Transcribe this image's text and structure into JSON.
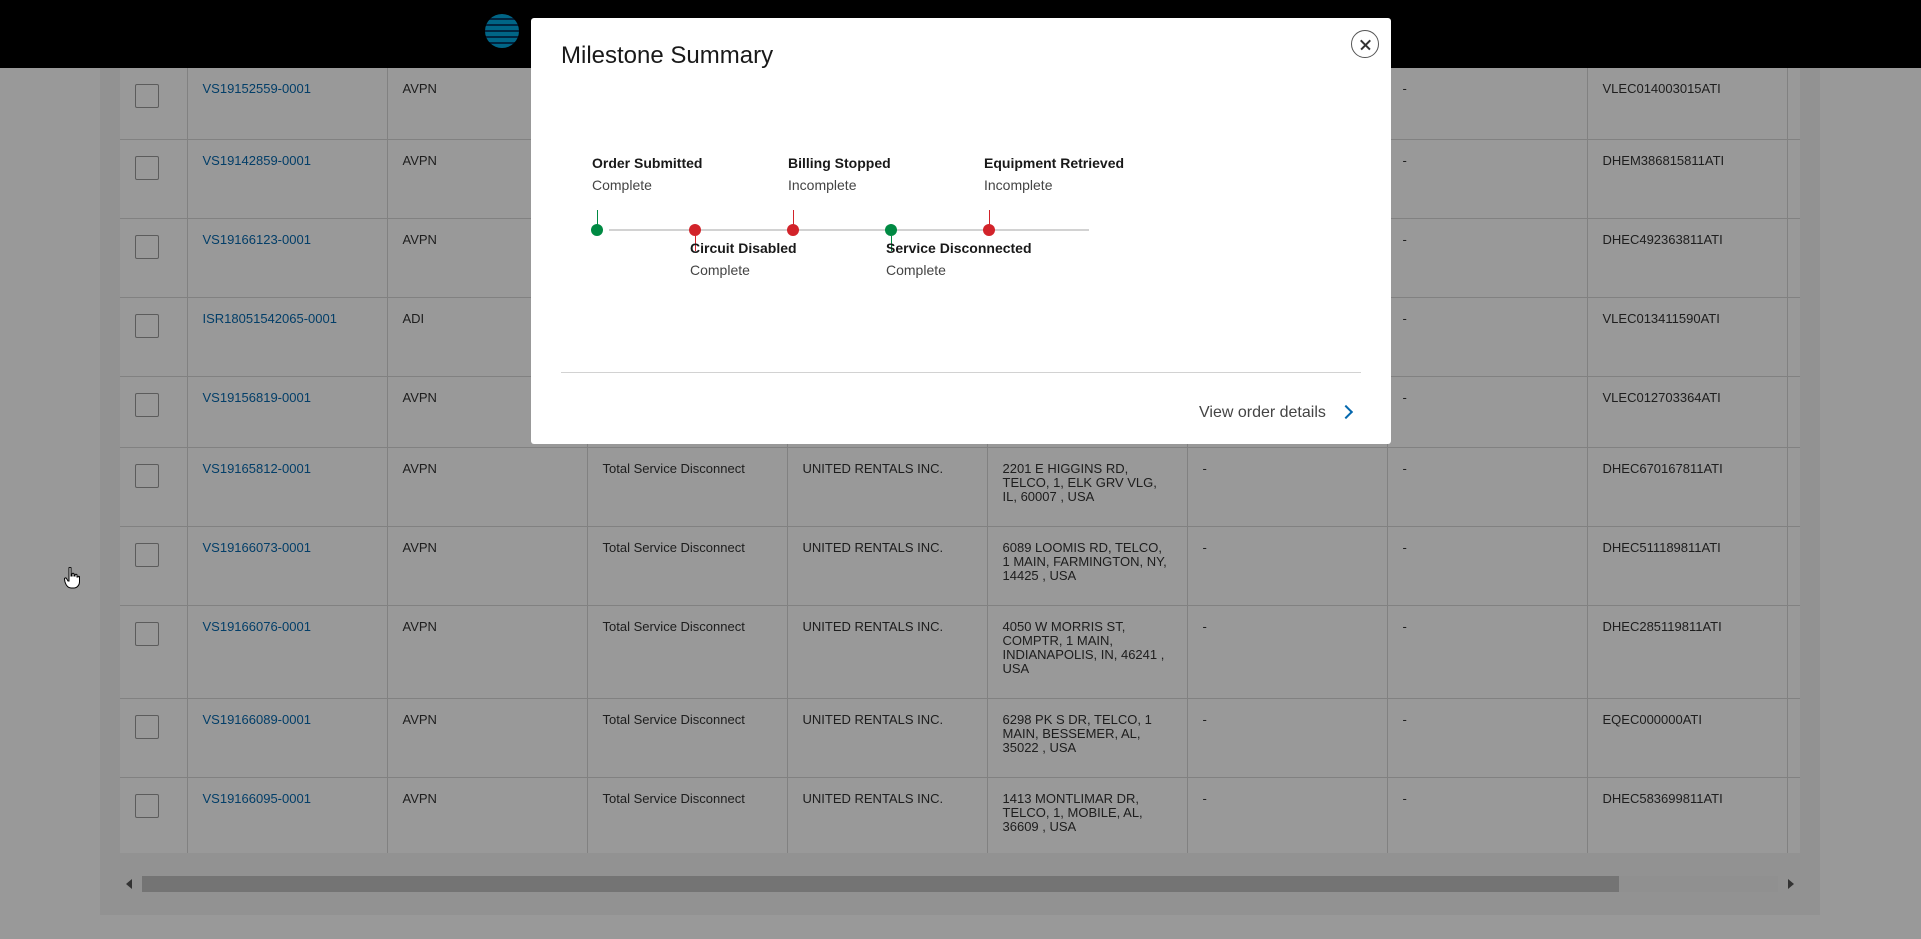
{
  "table": {
    "rows": [
      {
        "order": "VS19152559-0001",
        "product": "AVPN",
        "type": "",
        "customer": "",
        "address": "",
        "col_a": "",
        "col_b": "-",
        "circuit": "VLEC014003015ATI"
      },
      {
        "order": "VS19142859-0001",
        "product": "AVPN",
        "type": "",
        "customer": "",
        "address": "",
        "col_a": "",
        "col_b": "-",
        "circuit": "DHEM386815811ATI"
      },
      {
        "order": "VS19166123-0001",
        "product": "AVPN",
        "type": "",
        "customer": "",
        "address": "",
        "col_a": "",
        "col_b": "-",
        "circuit": "DHEC492363811ATI"
      },
      {
        "order": "ISR18051542065-0001",
        "product": "ADI",
        "type": "",
        "customer": "",
        "address": "",
        "col_a": "",
        "col_b": "-",
        "circuit": "VLEC013411590ATI"
      },
      {
        "order": "VS19156819-0001",
        "product": "AVPN",
        "type": "",
        "customer": "",
        "address": "",
        "col_a": "",
        "col_b": "-",
        "circuit": "VLEC012703364ATI"
      },
      {
        "order": "VS19165812-0001",
        "product": "AVPN",
        "type": "Total Service Disconnect",
        "customer": "UNITED RENTALS INC.",
        "address": "2201 E HIGGINS RD, TELCO, 1, ELK GRV VLG, IL, 60007 , USA",
        "col_a": "-",
        "col_b": "-",
        "circuit": "DHEC670167811ATI"
      },
      {
        "order": "VS19166073-0001",
        "product": "AVPN",
        "type": "Total Service Disconnect",
        "customer": "UNITED RENTALS INC.",
        "address": "6089 LOOMIS RD, TELCO, 1 MAIN, FARMINGTON, NY, 14425 , USA",
        "col_a": "-",
        "col_b": "-",
        "circuit": "DHEC511189811ATI"
      },
      {
        "order": "VS19166076-0001",
        "product": "AVPN",
        "type": "Total Service Disconnect",
        "customer": "UNITED RENTALS INC.",
        "address": "4050 W MORRIS ST, COMPTR, 1 MAIN, INDIANAPOLIS, IN, 46241 , USA",
        "col_a": "-",
        "col_b": "-",
        "circuit": "DHEC285119811ATI"
      },
      {
        "order": "VS19166089-0001",
        "product": "AVPN",
        "type": "Total Service Disconnect",
        "customer": "UNITED RENTALS INC.",
        "address": "6298 PK S DR, TELCO, 1 MAIN, BESSEMER, AL, 35022 , USA",
        "col_a": "-",
        "col_b": "-",
        "circuit": "EQEC000000ATI"
      },
      {
        "order": "VS19166095-0001",
        "product": "AVPN",
        "type": "Total Service Disconnect",
        "customer": "UNITED RENTALS INC.",
        "address": "1413 MONTLIMAR DR, TELCO, 1, MOBILE, AL, 36609 , USA",
        "col_a": "-",
        "col_b": "-",
        "circuit": "DHEC583699811ATI"
      }
    ]
  },
  "modal": {
    "title": "Milestone Summary",
    "milestones": [
      {
        "label": "Order Submitted",
        "status": "Complete",
        "color": "#008a43"
      },
      {
        "label": "Circuit Disabled",
        "status": "Complete",
        "color": "#d2232a"
      },
      {
        "label": "Billing Stopped",
        "status": "Incomplete",
        "color": "#d2232a"
      },
      {
        "label": "Service Disconnected",
        "status": "Complete",
        "color": "#008a43"
      },
      {
        "label": "Equipment Retrieved",
        "status": "Incomplete",
        "color": "#d2232a"
      }
    ],
    "details_link": "View order details"
  },
  "colors": {
    "link": "#0568ae",
    "complete": "#008a43",
    "incomplete": "#d2232a"
  },
  "icons": {
    "close": "close-icon",
    "chevron": "chevron-right-icon",
    "logo": "att-logo-icon",
    "cursor": "hand-cursor-icon"
  }
}
